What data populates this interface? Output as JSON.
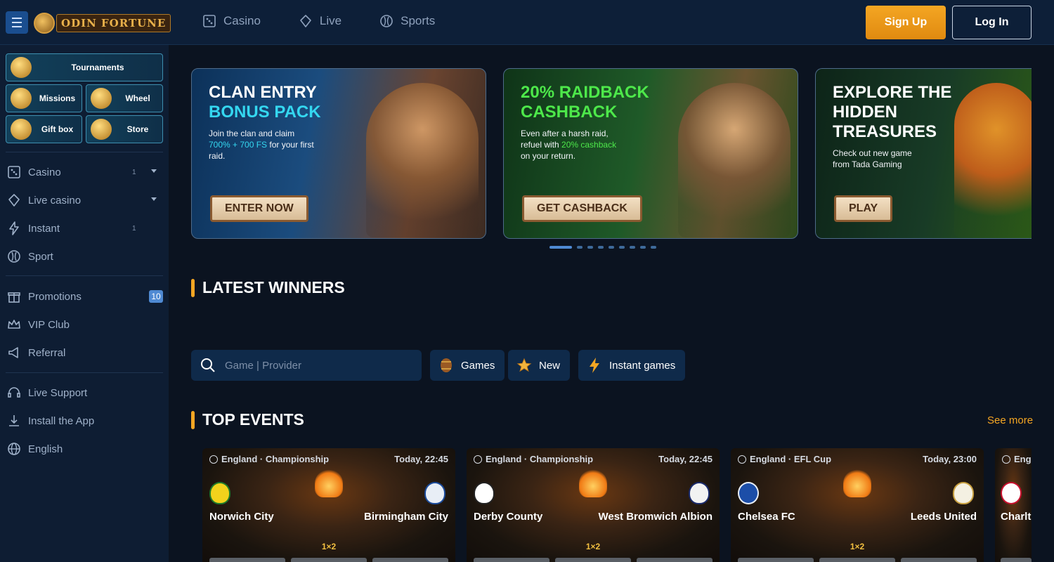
{
  "header": {
    "logo_text": "ODIN FORTUNE",
    "nav": [
      {
        "label": "Casino",
        "icon": "dice-icon"
      },
      {
        "label": "Live",
        "icon": "poker-chip-icon"
      },
      {
        "label": "Sports",
        "icon": "soccer-ball-icon"
      }
    ],
    "signup_label": "Sign Up",
    "login_label": "Log In"
  },
  "sidebar": {
    "tiles": [
      {
        "label": "Tournaments",
        "icon": "trophy-icon"
      },
      {
        "label": "Missions",
        "icon": "missions-icon"
      },
      {
        "label": "Wheel",
        "icon": "wheel-icon"
      },
      {
        "label": "Gift box",
        "icon": "gift-icon"
      },
      {
        "label": "Store",
        "icon": "gold-bars-icon"
      }
    ],
    "menu": [
      {
        "label": "Casino",
        "count": "1",
        "icon": "dice-icon"
      },
      {
        "label": "Live casino",
        "icon": "poker-chip-icon"
      },
      {
        "label": "Instant",
        "count": "1",
        "icon": "lightning-icon"
      },
      {
        "label": "Sport",
        "icon": "soccer-ball-icon"
      }
    ],
    "menu2": [
      {
        "label": "Promotions",
        "badge": "10",
        "icon": "gift-icon"
      },
      {
        "label": "VIP Club",
        "icon": "crown-icon"
      },
      {
        "label": "Referral",
        "icon": "megaphone-icon"
      }
    ],
    "menu3": [
      {
        "label": "Live Support",
        "icon": "headset-icon"
      },
      {
        "label": "Install the App",
        "icon": "download-icon"
      },
      {
        "label": "English",
        "icon": "globe-icon"
      }
    ]
  },
  "banners": [
    {
      "title_line1": "CLAN ENTRY",
      "title_line2": "BONUS PACK",
      "text_before": "Join the clan and claim ",
      "text_highlight": "700% + 700 FS",
      "text_after": " for your first raid.",
      "button": "ENTER NOW"
    },
    {
      "title_line1": "20% RAIDBACK",
      "title_line2": "CASHBACK",
      "text_before": "Even after a harsh raid, refuel with ",
      "text_highlight": "20% cashback",
      "text_after": " on your return.",
      "button": "GET CASHBACK"
    },
    {
      "title_line1": "EXPLORE THE",
      "title_line2": "HIDDEN",
      "title_line3": "TREASURES",
      "text": "Check out new game from Tada Gaming",
      "button": "PLAY"
    }
  ],
  "carousel": {
    "total": 9,
    "active": 1
  },
  "latest_winners_title": "LATEST WINNERS",
  "search": {
    "placeholder": "Game | Provider"
  },
  "filters": [
    {
      "label": "Games",
      "icon": "barrel-icon"
    },
    {
      "label": "New",
      "icon": "star-icon"
    },
    {
      "label": "Instant games",
      "icon": "lightning-icon"
    }
  ],
  "top_events": {
    "title": "TOP EVENTS",
    "see_more": "See more",
    "events": [
      {
        "league": "England · Championship",
        "time": "Today, 22:45",
        "home": "Norwich City",
        "away": "Birmingham City",
        "market": "1×2"
      },
      {
        "league": "England · Championship",
        "time": "Today, 22:45",
        "home": "Derby County",
        "away": "West Bromwich Albion",
        "market": "1×2"
      },
      {
        "league": "England · EFL Cup",
        "time": "Today, 23:00",
        "home": "Chelsea FC",
        "away": "Leeds United",
        "market": "1×2"
      },
      {
        "league": "Eng",
        "home": "Charlt"
      }
    ]
  }
}
